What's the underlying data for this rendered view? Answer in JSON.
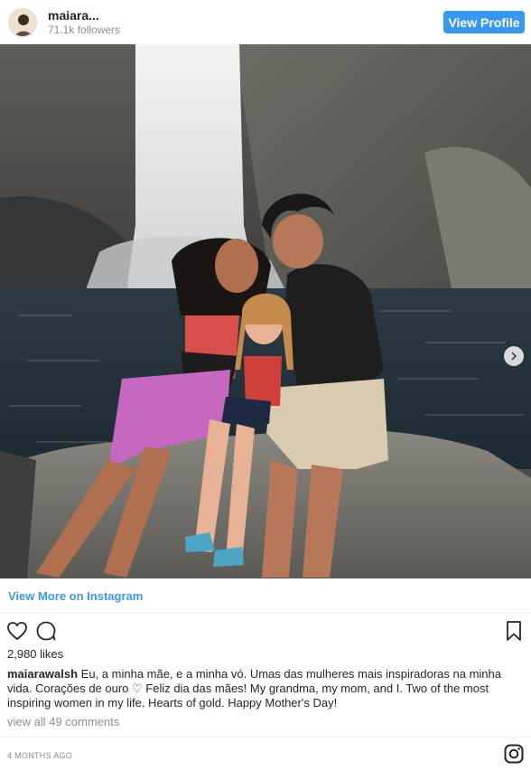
{
  "header": {
    "username": "maiara...",
    "followers": "71.1k followers",
    "view_profile_label": "View Profile"
  },
  "post": {
    "view_more_label": "View More on Instagram",
    "likes": "2,980 likes",
    "caption_user": "maiarawalsh",
    "caption_text": "Eu, a minha mãe, e a minha vó. Umas das mulheres mais inspiradoras na minha vida. Corações de ouro ♡ Feliz dia das mães! My grandma, my mom, and I. Two of the most inspiring women in my life. Hearts of gold. Happy Mother's Day!",
    "comments_label": "view all 49 comments",
    "timestamp": "4 MONTHS AGO"
  },
  "icons": {
    "like": "heart-icon",
    "comment": "comment-icon",
    "save": "bookmark-icon",
    "carousel_next": "chevron-right-icon",
    "brand": "instagram-icon"
  },
  "colors": {
    "primary_button": "#3897f0",
    "link": "#3897f0",
    "text": "#262626",
    "muted": "#8e8e8e"
  }
}
